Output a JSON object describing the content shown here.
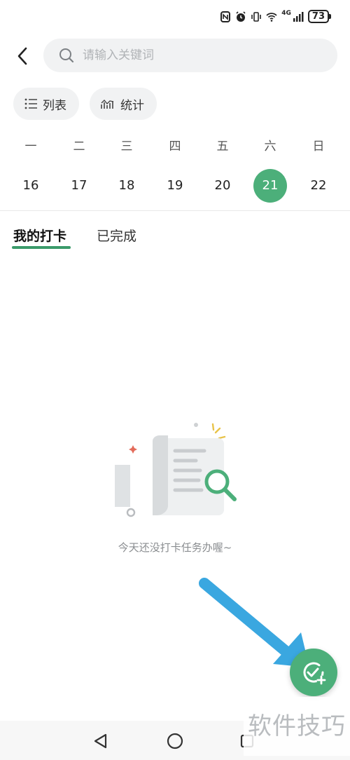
{
  "status_bar": {
    "battery": "73",
    "network": "4G"
  },
  "search": {
    "placeholder": "请输入关键词"
  },
  "view_chips": {
    "list_label": "列表",
    "stats_label": "统计"
  },
  "calendar": {
    "weekdays": [
      "一",
      "二",
      "三",
      "四",
      "五",
      "六",
      "日"
    ],
    "dates": [
      "16",
      "17",
      "18",
      "19",
      "20",
      "21",
      "22"
    ],
    "selected": "21",
    "accent_color": "#4caf7a"
  },
  "tabs": {
    "mine": "我的打卡",
    "done": "已完成"
  },
  "empty_state": {
    "message": "今天还没打卡任务办喔~"
  },
  "watermark": "软件技巧"
}
